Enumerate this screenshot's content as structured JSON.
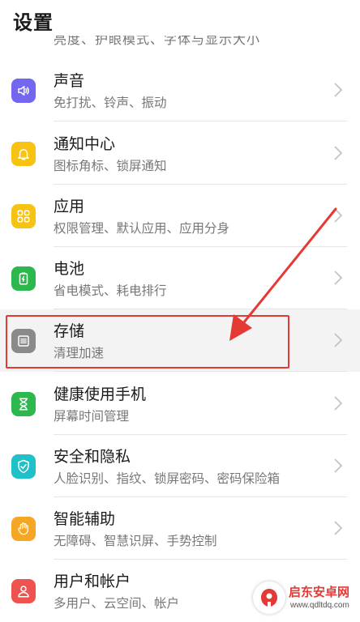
{
  "header": {
    "title": "设置"
  },
  "clipped_row": {
    "subtitle": "亮度、护眼模式、字体与显示大小"
  },
  "items": [
    {
      "title": "声音",
      "subtitle": "免打扰、铃声、振动",
      "icon": "speaker-icon",
      "color": "#7367f0"
    },
    {
      "title": "通知中心",
      "subtitle": "图标角标、锁屏通知",
      "icon": "bell-icon",
      "color": "#f7c211"
    },
    {
      "title": "应用",
      "subtitle": "权限管理、默认应用、应用分身",
      "icon": "apps-grid-icon",
      "color": "#f7c211"
    },
    {
      "title": "电池",
      "subtitle": "省电模式、耗电排行",
      "icon": "battery-icon",
      "color": "#2db84d"
    },
    {
      "title": "存储",
      "subtitle": "清理加速",
      "icon": "storage-icon",
      "color": "#8a8a8a"
    },
    {
      "title": "健康使用手机",
      "subtitle": "屏幕时间管理",
      "icon": "hourglass-icon",
      "color": "#2db84d"
    },
    {
      "title": "安全和隐私",
      "subtitle": "人脸识别、指纹、锁屏密码、密码保险箱",
      "icon": "shield-icon",
      "color": "#1fc0c8"
    },
    {
      "title": "智能辅助",
      "subtitle": "无障碍、智慧识屏、手势控制",
      "icon": "hand-icon",
      "color": "#f5a623"
    },
    {
      "title": "用户和帐户",
      "subtitle": "多用户、云空间、帐户",
      "icon": "user-icon",
      "color": "#ef5350"
    }
  ],
  "annotation": {
    "color": "#e53935"
  },
  "watermark": {
    "title": "启东安卓网",
    "url": "www.qdltdq.com"
  }
}
